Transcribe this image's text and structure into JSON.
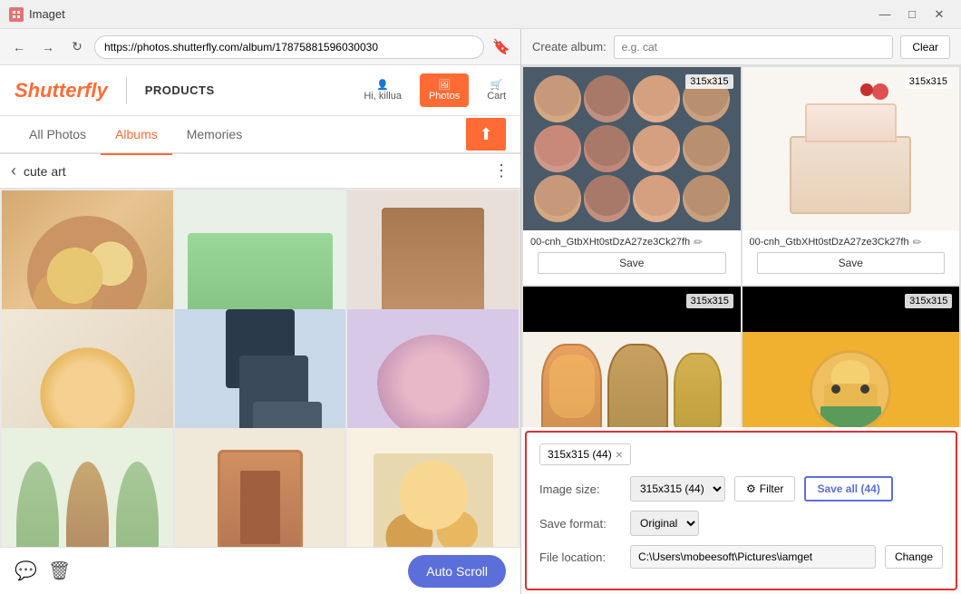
{
  "app": {
    "title": "Imaget",
    "icon": "🖼"
  },
  "titlebar": {
    "minimize": "—",
    "maximize": "□",
    "close": "✕"
  },
  "browser": {
    "url": "https://photos.shutterfly.com/album/17875881596030030",
    "back": "←",
    "forward": "→",
    "refresh": "↻"
  },
  "site": {
    "logo": "Shutterfly",
    "divider": "|",
    "products": "PRODUCTS",
    "nav": {
      "hi_user": "Hi, killua",
      "photos": "Photos",
      "cart": "Cart"
    }
  },
  "tabs": {
    "all_photos": "All Photos",
    "albums": "Albums",
    "memories": "Memories"
  },
  "album": {
    "name": "cute art",
    "back": "‹",
    "more": "⋮"
  },
  "bottom": {
    "comment_icon": "💬",
    "trash_icon": "🗑",
    "auto_scroll": "Auto Scroll"
  },
  "right_panel": {
    "create_album_label": "Create album:",
    "album_placeholder": "e.g. cat",
    "clear_btn": "Clear"
  },
  "images": [
    {
      "badge": "315x315",
      "filename": "00-cnh_GtbXHt0stDzA27ze3Ck27fh",
      "save_label": "Save",
      "type": "cupcake"
    },
    {
      "badge": "315x315",
      "filename": "00-cnh_GtbXHt0stDzA27ze3Ck27fh",
      "save_label": "Save",
      "type": "cake"
    },
    {
      "badge": "315x315",
      "filename": "",
      "save_label": "",
      "type": "fruitjar"
    },
    {
      "badge": "315x315",
      "filename": "",
      "save_label": "",
      "type": "girl"
    }
  ],
  "filter": {
    "tag_label": "315x315 (44)",
    "tag_remove": "×",
    "image_size_label": "Image size:",
    "image_size_value": "315x315 (44)",
    "filter_icon": "⚙",
    "filter_btn": "Filter",
    "save_all_btn": "Save all (44)",
    "save_format_label": "Save format:",
    "format_value": "Original",
    "file_location_label": "File location:",
    "file_path": "C:\\Users\\mobeesoft\\Pictures\\iamget",
    "change_btn": "Change"
  }
}
